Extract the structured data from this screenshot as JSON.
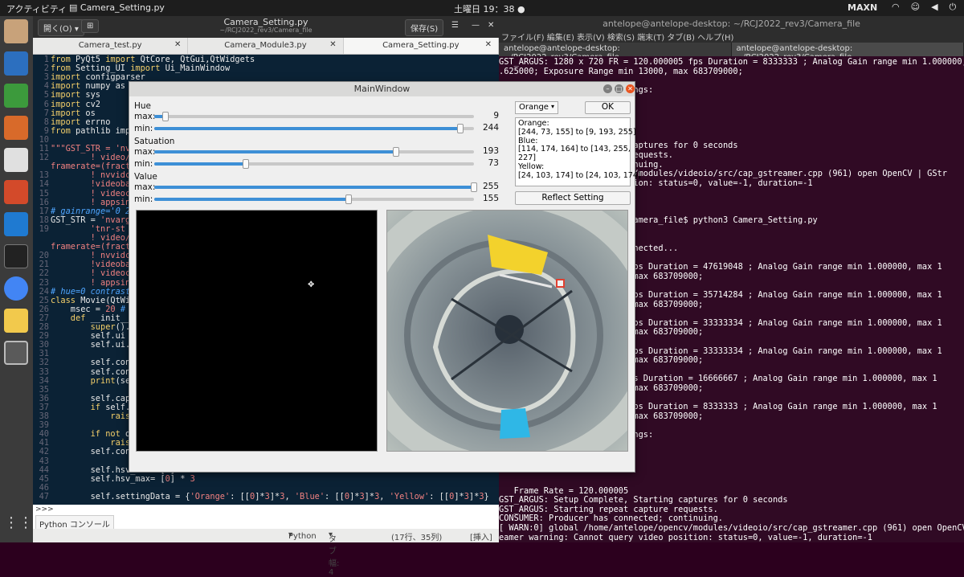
{
  "topbar": {
    "activities": "アクティビティ",
    "app_name": "Camera_Setting.py",
    "clock": "土曜日 19：38",
    "clock_dot": "●",
    "network": "MAXN"
  },
  "editor": {
    "title": "Camera_Setting.py",
    "subtitle": "~/RCJ2022_rev3/Camera_file",
    "open_label": "開く(O)",
    "save_label": "保存(S)",
    "tabs": [
      {
        "label": "Camera_test.py"
      },
      {
        "label": "Camera_Module3.py"
      },
      {
        "label": "Camera_Setting.py"
      }
    ],
    "console_prompt": ">>>",
    "console_button": "Python コンソール",
    "status": {
      "language": "Python",
      "tab_width": "タブ幅: 4",
      "position": "(17行、35列)",
      "mode": "[挿入]"
    }
  },
  "code_lines": [
    [
      "1",
      [
        [
          "kw",
          "from "
        ],
        [
          "",
          "PyQt5 "
        ],
        [
          "kw",
          "import "
        ],
        [
          "",
          "QtCore, QtGui,QtWidgets"
        ]
      ]
    ],
    [
      "2",
      [
        [
          "kw",
          "from "
        ],
        [
          "",
          "Setting_UI "
        ],
        [
          "kw",
          "import "
        ],
        [
          "",
          "Ui_MainWindow"
        ]
      ]
    ],
    [
      "3",
      [
        [
          "kw",
          "import "
        ],
        [
          "",
          "configparser"
        ]
      ]
    ],
    [
      "4",
      [
        [
          "kw",
          "import "
        ],
        [
          "",
          "numpy as n"
        ]
      ]
    ],
    [
      "5",
      [
        [
          "kw",
          "import "
        ],
        [
          "",
          "sys"
        ]
      ]
    ],
    [
      "6",
      [
        [
          "kw",
          "import "
        ],
        [
          "",
          "cv2"
        ]
      ]
    ],
    [
      "7",
      [
        [
          "kw",
          "import "
        ],
        [
          "",
          "os"
        ]
      ]
    ],
    [
      "8",
      [
        [
          "kw",
          "import "
        ],
        [
          "",
          "errno"
        ]
      ]
    ],
    [
      "9",
      [
        [
          "kw",
          "from "
        ],
        [
          "",
          "pathlib impo"
        ]
      ]
    ],
    [
      "10",
      [
        [
          "",
          ""
        ]
      ]
    ],
    [
      "11",
      [
        [
          "st",
          "\"\"\"GST_STR = 'nva"
        ]
      ]
    ],
    [
      "12",
      [
        [
          "st",
          "        ! video/x"
        ]
      ]
    ],
    [
      "",
      [
        [
          "st",
          "framerate=(fracti"
        ]
      ]
    ],
    [
      "13",
      [
        [
          "st",
          "        ! nvvidco"
        ]
      ]
    ],
    [
      "14",
      [
        [
          "st",
          "        !videobal"
        ]
      ]
    ],
    [
      "15",
      [
        [
          "st",
          "        ! videoco"
        ]
      ]
    ],
    [
      "16",
      [
        [
          "st",
          "        ! appsink"
        ]
      ]
    ],
    [
      "17",
      [
        [
          "cm",
          "# gainrange='0 26"
        ]
      ]
    ],
    [
      "18",
      [
        [
          "",
          "GST_STR = "
        ],
        [
          "st",
          "'nvargu"
        ]
      ]
    ],
    [
      "19",
      [
        [
          "st",
          "        'tnr-st"
        ]
      ]
    ],
    [
      "",
      [
        [
          "st",
          "        ! video/x"
        ]
      ]
    ],
    [
      "",
      [
        [
          "st",
          "framerate=(fracti"
        ]
      ]
    ],
    [
      "20",
      [
        [
          "st",
          "        ! nvvidco"
        ]
      ]
    ],
    [
      "21",
      [
        [
          "st",
          "        !videobal"
        ]
      ]
    ],
    [
      "22",
      [
        [
          "st",
          "        ! videoco"
        ]
      ]
    ],
    [
      "23",
      [
        [
          "st",
          "        ! appsink"
        ]
      ]
    ],
    [
      "24",
      [
        [
          "cm",
          "# hue=0 contrast="
        ]
      ]
    ],
    [
      "25",
      [
        [
          "kw",
          "class "
        ],
        [
          "",
          "Movie(QtWid"
        ]
      ]
    ],
    [
      "26",
      [
        [
          "",
          "    msec = "
        ],
        [
          "st",
          "20 "
        ],
        [
          "cm",
          "# m"
        ]
      ]
    ],
    [
      "27",
      [
        [
          "kw",
          "    def "
        ],
        [
          "",
          "__init__("
        ]
      ]
    ],
    [
      "28",
      [
        [
          "",
          "        "
        ],
        [
          "kw",
          "super"
        ],
        [
          "",
          "()._"
        ]
      ]
    ],
    [
      "29",
      [
        [
          "",
          "        self.ui ="
        ]
      ]
    ],
    [
      "30",
      [
        [
          "",
          "        self.ui.s"
        ]
      ]
    ],
    [
      "31",
      [
        [
          "",
          ""
        ]
      ]
    ],
    [
      "32",
      [
        [
          "",
          "        self.conf"
        ]
      ]
    ],
    [
      "33",
      [
        [
          "",
          "        self.conf"
        ]
      ]
    ],
    [
      "34",
      [
        [
          "",
          "        "
        ],
        [
          "kw",
          "print"
        ],
        [
          "",
          "(sel"
        ]
      ]
    ],
    [
      "35",
      [
        [
          "",
          ""
        ]
      ]
    ],
    [
      "36",
      [
        [
          "",
          "        self.capt"
        ]
      ]
    ],
    [
      "37",
      [
        [
          "kw",
          "        if "
        ],
        [
          "",
          "self.c"
        ]
      ]
    ],
    [
      "38",
      [
        [
          "kw",
          "            raise"
        ]
      ]
    ],
    [
      "39",
      [
        [
          "",
          ""
        ]
      ]
    ],
    [
      "40",
      [
        [
          "kw",
          "        if not "
        ],
        [
          "",
          "os"
        ]
      ]
    ],
    [
      "41",
      [
        [
          "kw",
          "            raise"
        ]
      ]
    ],
    [
      "42",
      [
        [
          "",
          "        self.conf"
        ]
      ]
    ],
    [
      "43",
      [
        [
          "",
          ""
        ]
      ]
    ],
    [
      "44",
      [
        [
          "",
          "        self.hsv_min= ["
        ],
        [
          "st",
          "0"
        ],
        [
          "",
          "] * "
        ],
        [
          "st",
          "3"
        ]
      ]
    ],
    [
      "45",
      [
        [
          "",
          "        self.hsv_max= ["
        ],
        [
          "st",
          "0"
        ],
        [
          "",
          "] * "
        ],
        [
          "st",
          "3"
        ]
      ]
    ],
    [
      "46",
      [
        [
          "",
          ""
        ]
      ]
    ],
    [
      "47",
      [
        [
          "",
          "        self.settingData = {"
        ],
        [
          "st",
          "'Orange'"
        ],
        [
          "",
          ": [["
        ],
        [
          "st",
          "0"
        ],
        [
          "",
          "]*"
        ],
        [
          "st",
          "3"
        ],
        [
          "",
          "]*"
        ],
        [
          "st",
          "3"
        ],
        [
          "",
          ", "
        ],
        [
          "st",
          "'Blue'"
        ],
        [
          "",
          ": [["
        ],
        [
          "st",
          "0"
        ],
        [
          "",
          "]*"
        ],
        [
          "st",
          "3"
        ],
        [
          "",
          "]*"
        ],
        [
          "st",
          "3"
        ],
        [
          "",
          ", "
        ],
        [
          "st",
          "'Yellow'"
        ],
        [
          "",
          ": [["
        ],
        [
          "st",
          "0"
        ],
        [
          "",
          "]*"
        ],
        [
          "st",
          "3"
        ],
        [
          "",
          "]*"
        ],
        [
          "st",
          "3"
        ],
        [
          "",
          "}"
        ]
      ]
    ]
  ],
  "terminal": {
    "title": "antelope@antelope-desktop: ~/RCJ2022_rev3/Camera_file",
    "menu": "ファイル(F)  編集(E)  表示(V)  検索(S)  端末(T)  タブ(B)  ヘルプ(H)",
    "tabs": [
      {
        "label": "antelope@antelope-desktop: ~/RCJ2022_rev3/Camera_file"
      },
      {
        "label": "antelope@antelope-desktop: ~/RCJ2022_rev3/Camera_file"
      }
    ],
    "lines": [
      "GST_ARGUS: 1280 x 720 FR = 120.000005 fps Duration = 8333333 ; Analog Gain range min 1.000000, max 10",
      ".625000; Exposure Range min 13000, max 683709000;",
      "",
      "                  ing settings:",
      "",
      "",
      "                  720",
      "",
      "",
      "                  tarting captures for 0 seconds",
      "                  capture requests.",
      "                  ed; continuing.",
      "                  pe/opencv/modules/videoio/src/cap_gstreamer.cpp (961) open OpenCV | GStr",
      "                  deo position: status=0, value=-1, duration=-1",
      "",
      "",
      "",
      "               J2022_rev3/Camera_file$ python3 Camera_Setting.py",
      "                  nfig.ini",
      "                  eam",
      "                  er is connected...",
      "                  des :",
      "                  .000000 fps Duration = 47619048 ; Analog Gain range min 1.000000, max 1",
      "                  .000000, max 683709000;",
      "",
      "                  .000001 fps Duration = 35714284 ; Analog Gain range min 1.000000, max 1",
      "                  .000000, max 683709000;",
      "",
      "                  .999999 fps Duration = 33333334 ; Analog Gain range min 1.000000, max 1",
      "                  .000000, max 683709000;",
      "",
      "                  .999999 fps Duration = 33333334 ; Analog Gain range min 1.000000, max 1",
      "                  .000000, max 683709000;",
      "",
      "                  999999 fps Duration = 16666667 ; Analog Gain range min 1.000000, max 1",
      "                  .000000, max 683709000;",
      "",
      "                  .000005 fps Duration = 8333333 ; Analog Gain range min 1.000000, max 1",
      "                  .000000, max 683709000;",
      "",
      "                  ing settings:",
      "",
      "",
      "                  720",
      "",
      "",
      "   Frame Rate = 120.000005",
      "GST_ARGUS: Setup Complete, Starting captures for 0 seconds",
      "GST_ARGUS: Starting repeat capture requests.",
      "CONSUMER: Producer has connected; continuing.",
      "[ WARN:0] global /home/antelope/opencv/modules/videoio/src/cap_gstreamer.cpp (961) open OpenCV | GStr",
      "eamer warning: Cannot query video position: status=0, value=-1, duration=-1"
    ]
  },
  "qt": {
    "title": "MainWindow",
    "hue_label": "Hue",
    "saturation_label": "Satuation",
    "value_label": "Value",
    "max_label": "max:",
    "min_label": "min:",
    "sliders": [
      {
        "group": "hue",
        "kind": "max",
        "value": 9,
        "range": 255
      },
      {
        "group": "hue",
        "kind": "min",
        "value": 244,
        "range": 255
      },
      {
        "group": "saturation",
        "kind": "max",
        "value": 193,
        "range": 255
      },
      {
        "group": "saturation",
        "kind": "min",
        "value": 73,
        "range": 255
      },
      {
        "group": "value",
        "kind": "max",
        "value": 255,
        "range": 255
      },
      {
        "group": "value",
        "kind": "min",
        "value": 155,
        "range": 255
      }
    ],
    "combo_value": "Orange",
    "ok_label": "OK",
    "info_text": "Orange:\n[244, 73, 155] to [9, 193, 255]\nBlue:\n[114, 174, 164] to [143, 255,\n227]\nYellow:\n[24, 103, 174] to [24, 103, 174]",
    "reflect_label": "Reflect Setting",
    "accent": "#3d8fd6"
  }
}
